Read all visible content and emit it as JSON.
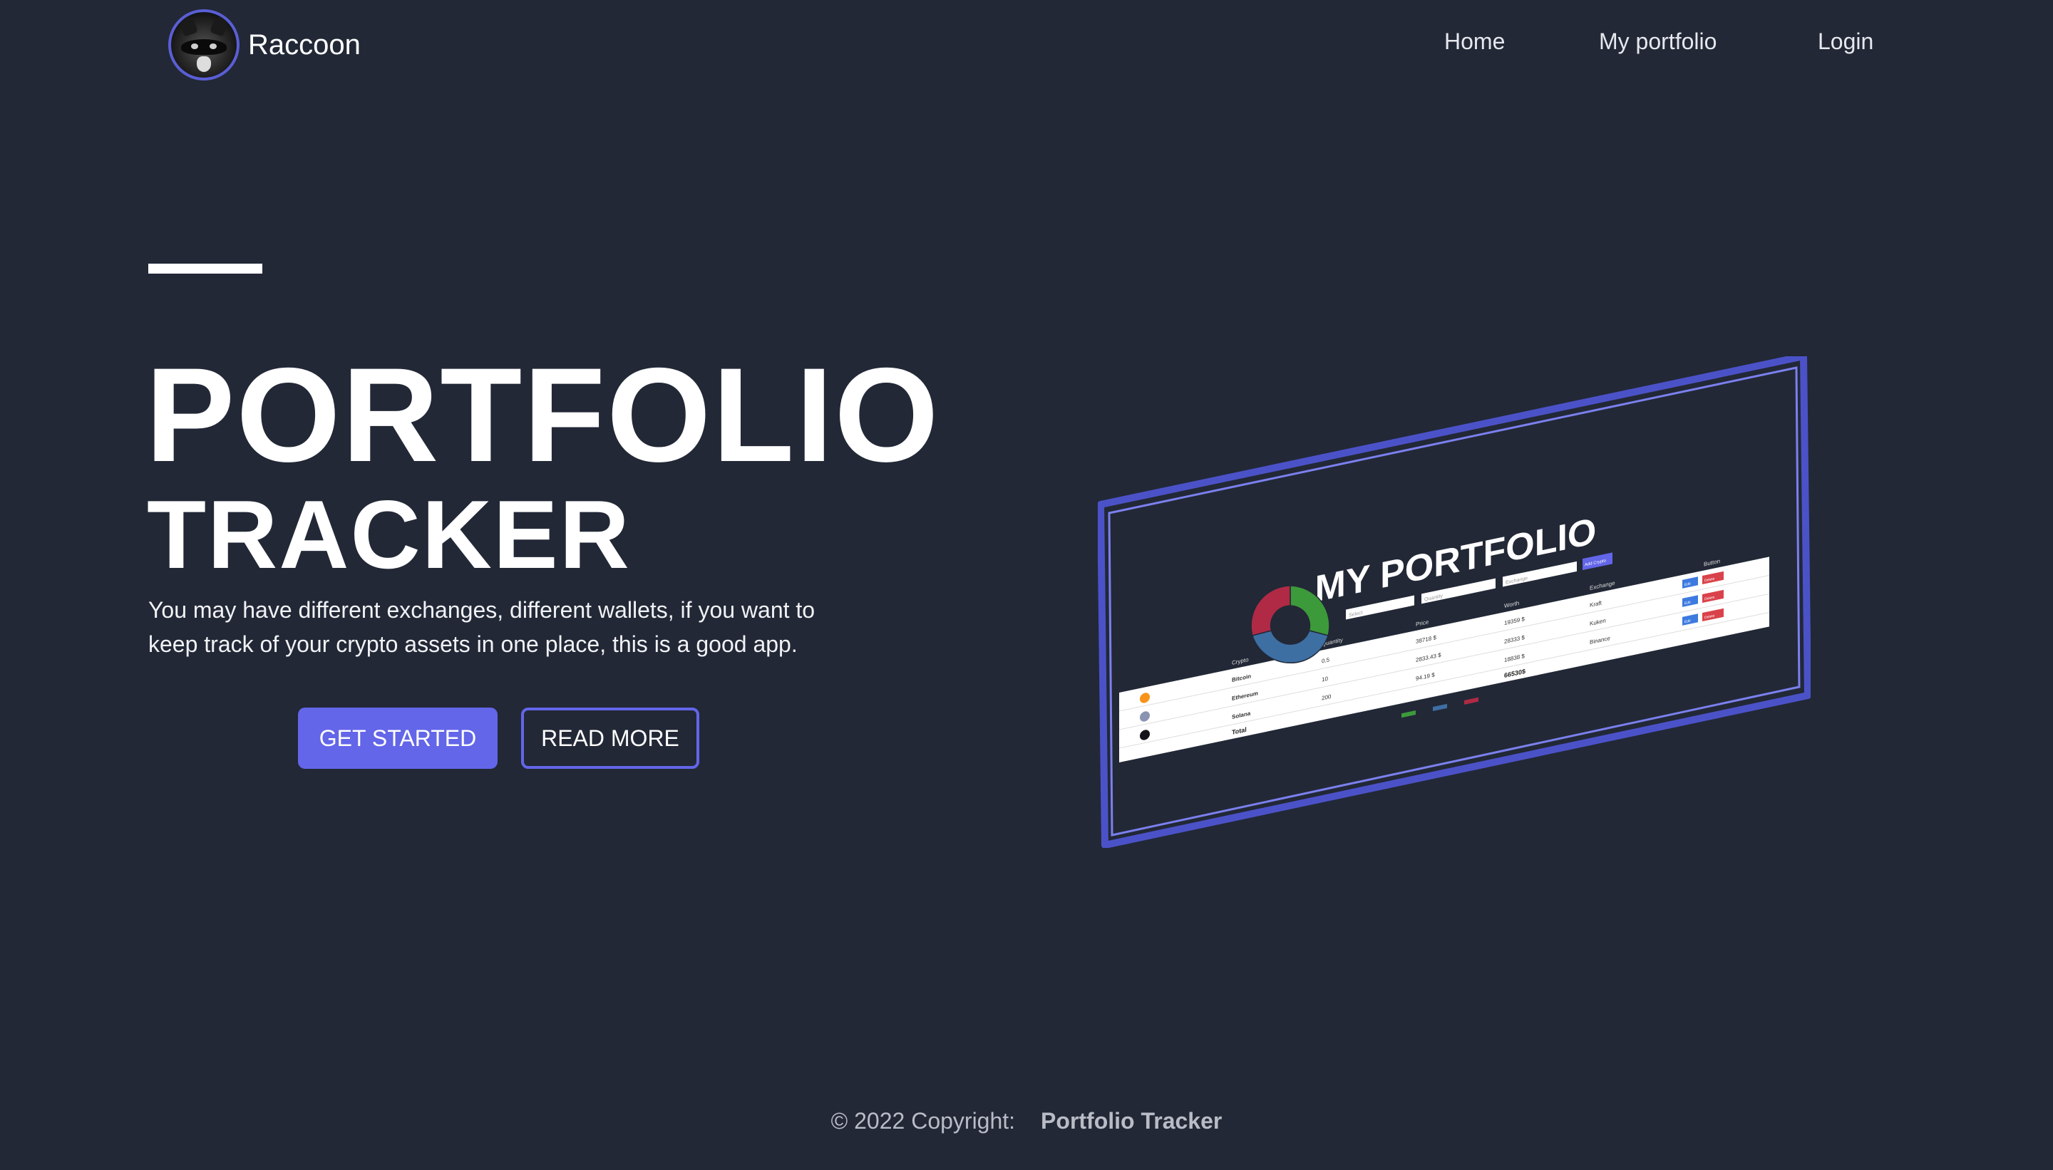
{
  "nav": {
    "brand": "Raccoon",
    "items": [
      {
        "label": "Home"
      },
      {
        "label": "My portfolio"
      },
      {
        "label": "Login"
      }
    ]
  },
  "hero": {
    "title_line1": "PORTFOLIO",
    "title_line2": "TRACKER",
    "description": "You may have different exchanges, different wallets, if you want to keep track of your crypto assets in one place, this is a good app.",
    "primary_button": "GET STARTED",
    "secondary_button": "READ MORE"
  },
  "preview": {
    "title": "MY PORTFOLIO",
    "add_button": "Add Crypto",
    "inputs": [
      "Select",
      "Quantity",
      "Exchange"
    ],
    "columns": [
      "Crypto",
      "Quantity",
      "Price",
      "Worth",
      "Exchange",
      "Button"
    ],
    "rows": [
      {
        "name": "Bitcoin",
        "quantity": "0.5",
        "price": "38718 $",
        "worth": "19359 $",
        "exchange": "Kraft",
        "edit": "Edit",
        "delete": "Delete",
        "icon_color": "#f7931a"
      },
      {
        "name": "Ethereum",
        "quantity": "10",
        "price": "2833.43 $",
        "worth": "28333 $",
        "exchange": "Kuken",
        "edit": "Edit",
        "delete": "Delete",
        "icon_color": "#8a93b2"
      },
      {
        "name": "Solana",
        "quantity": "200",
        "price": "94.19 $",
        "worth": "18838 $",
        "exchange": "Binance",
        "edit": "Edit",
        "delete": "Delete",
        "icon_color": "#14141a"
      }
    ],
    "total_label": "Total",
    "total_value": "66530$",
    "donut": [
      {
        "value": 29,
        "color": "#3d9a3b"
      },
      {
        "value": 42,
        "color": "#3d6fa3"
      },
      {
        "value": 29,
        "color": "#b02a45"
      }
    ],
    "accent": "#5a5fd6"
  },
  "footer": {
    "copyright": "© 2022 Copyright:",
    "site": "Portfolio Tracker"
  }
}
